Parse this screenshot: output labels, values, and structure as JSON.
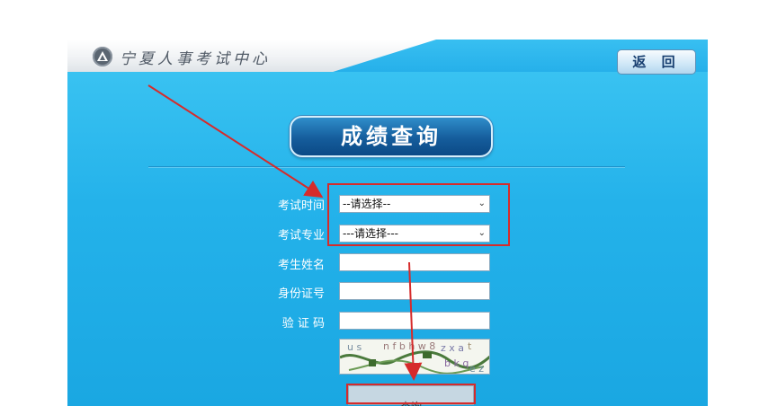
{
  "header": {
    "site_title": "宁夏人事考试中心",
    "back_label": "返 回"
  },
  "page": {
    "heading": "成绩查询"
  },
  "form": {
    "exam_time": {
      "label": "考试时间",
      "selected": "--请选择--"
    },
    "exam_major": {
      "label": "考试专业",
      "selected": "---请选择---"
    },
    "candidate_name": {
      "label": "考生姓名",
      "value": ""
    },
    "id_number": {
      "label": "身份证号",
      "value": ""
    },
    "captcha": {
      "label": "验 证 码",
      "value": "",
      "image_text": "usnfbhw8 zxa bkqtlxe"
    },
    "submit_label": "查询"
  },
  "icons": {
    "logo": "ndrc-emblem-icon",
    "select_chevron": "chevron-down-icon"
  },
  "colors": {
    "panel_blue": "#24b2ea",
    "heading_blue": "#155d9c",
    "annotation_red": "#d62b2b"
  }
}
